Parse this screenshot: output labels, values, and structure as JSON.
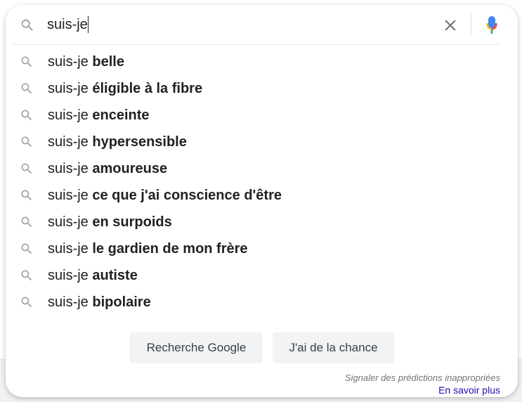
{
  "search": {
    "value": "suis-je",
    "placeholder": ""
  },
  "icons": {
    "search": "search-icon",
    "clear": "close-icon",
    "mic": "microphone-icon"
  },
  "colors": {
    "mic_blue": "#4285f4",
    "mic_red": "#ea4335",
    "mic_yellow": "#fbbc04",
    "mic_green": "#34a853",
    "link": "#1a0dab",
    "text": "#202124",
    "icon_gray": "#9aa0a6"
  },
  "suggestions": [
    {
      "prefix": "suis-je",
      "rest": "belle"
    },
    {
      "prefix": "suis-je",
      "rest": "éligible à la fibre"
    },
    {
      "prefix": "suis-je",
      "rest": "enceinte"
    },
    {
      "prefix": "suis-je",
      "rest": "hypersensible"
    },
    {
      "prefix": "suis-je",
      "rest": "amoureuse"
    },
    {
      "prefix": "suis-je",
      "rest": "ce que j'ai conscience d'être"
    },
    {
      "prefix": "suis-je",
      "rest": "en surpoids"
    },
    {
      "prefix": "suis-je",
      "rest": "le gardien de mon frère"
    },
    {
      "prefix": "suis-je",
      "rest": "autiste"
    },
    {
      "prefix": "suis-je",
      "rest": "bipolaire"
    }
  ],
  "buttons": {
    "search_label": "Recherche Google",
    "lucky_label": "J'ai de la chance"
  },
  "footer": {
    "report_label": "Signaler des prédictions inappropriées",
    "learn_more_label": "En savoir plus"
  }
}
